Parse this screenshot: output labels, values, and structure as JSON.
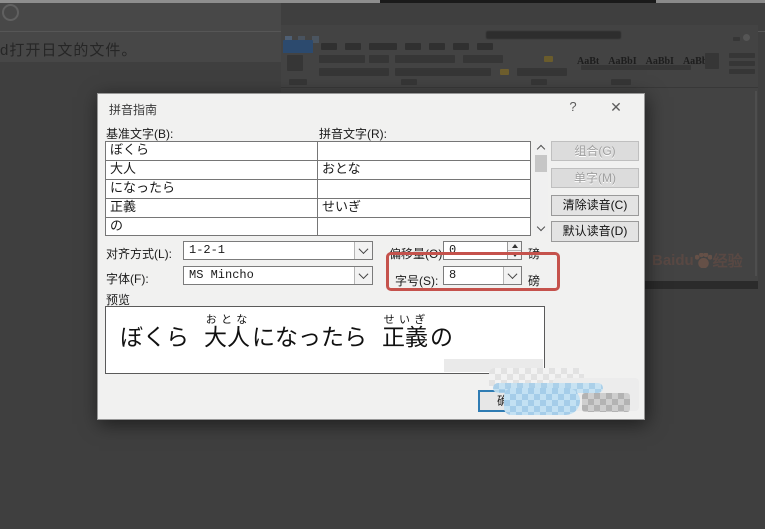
{
  "page": {
    "snippet_text": "d打开日文的文件。",
    "watermark_prefix": "Baidu",
    "watermark_suffix": "经验"
  },
  "word": {
    "styles_gallery": [
      "AaBt",
      "AaBbI",
      "AaBbI",
      "AaBbI"
    ]
  },
  "dialog": {
    "title": "拼音指南",
    "help_glyph": "?",
    "close_glyph": "✕",
    "base_label": "基准文字(B):",
    "ruby_label": "拼音文字(R):",
    "rows": [
      {
        "base": "ぼくら",
        "ruby": ""
      },
      {
        "base": "大人",
        "ruby": "おとな"
      },
      {
        "base": "になったら",
        "ruby": ""
      },
      {
        "base": "正義",
        "ruby": "せいぎ"
      },
      {
        "base": "の",
        "ruby": ""
      }
    ],
    "combine_btn": "组合(G)",
    "mono_btn": "单字(M)",
    "clear_btn": "清除读音(C)",
    "default_btn": "默认读音(D)",
    "align_label": "对齐方式(L):",
    "align_value": "1-2-1",
    "offset_label": "偏移量(O):",
    "offset_value": "0",
    "offset_unit": "磅",
    "font_label": "字体(F):",
    "font_value": "MS Mincho",
    "size_label": "字号(S):",
    "size_value": "8",
    "size_unit": "磅",
    "preview_label": "预览",
    "preview_parts": [
      {
        "t": "ぼくら",
        "r": ""
      },
      {
        "t": "大人",
        "r": "おとな"
      },
      {
        "t": "になったら",
        "r": ""
      },
      {
        "t": "正義",
        "r": "せいぎ"
      },
      {
        "t": "の",
        "r": ""
      }
    ],
    "ok_btn": "确定"
  },
  "colors": {
    "highlight_box": "#c5524c",
    "ok_focus_border": "#2f7cb3",
    "dim_overlay": "#3f3f3f"
  }
}
